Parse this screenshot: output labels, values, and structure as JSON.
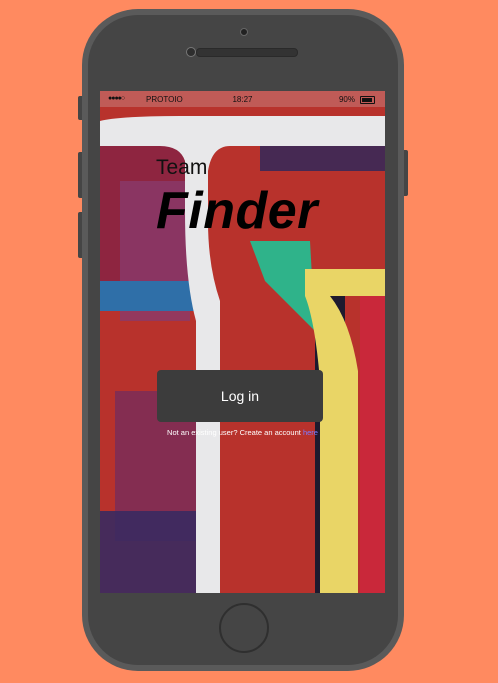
{
  "status_bar": {
    "signal": "●●●●○",
    "carrier": "PROTOIO",
    "time": "18:27",
    "battery": "90%"
  },
  "app": {
    "title_small": "Team",
    "title_big": "Finder"
  },
  "login": {
    "button_label": "Log in",
    "signup_prompt": "Not an existing user? Create an account ",
    "signup_link": "here"
  },
  "colors": {
    "background": "#ff8a60",
    "phone_body": "#5a5a5a",
    "button": "#3c3c3c",
    "link": "#7a7aff"
  }
}
